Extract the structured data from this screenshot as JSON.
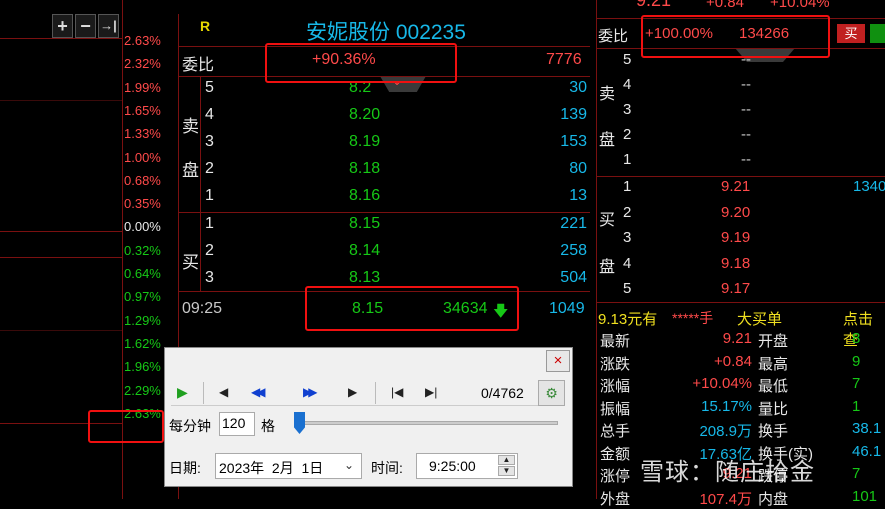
{
  "toolbar": {
    "add_label": "+",
    "minus_label": "−",
    "end_label": "→|"
  },
  "left_pcts": [
    "2.63%",
    "2.32%",
    "1.99%",
    "1.65%",
    "1.33%",
    "1.00%",
    "0.68%",
    "0.35%",
    "0.00%",
    "0.32%",
    "0.64%",
    "0.97%",
    "1.29%",
    "1.62%",
    "1.96%",
    "2.29%",
    "2.63%"
  ],
  "stock": {
    "marker": "R",
    "title": "安妮股份 002235"
  },
  "weibi": {
    "label": "委比",
    "value": "+90.36%",
    "diff": "7776"
  },
  "sell_label_1": "卖",
  "sell_label_2": "盘",
  "buy_label": "买",
  "sell_rows": [
    {
      "level": "5",
      "price": "8.2",
      "vol": "30"
    },
    {
      "level": "4",
      "price": "8.20",
      "vol": "139"
    },
    {
      "level": "3",
      "price": "8.19",
      "vol": "153"
    },
    {
      "level": "2",
      "price": "8.18",
      "vol": "80"
    },
    {
      "level": "1",
      "price": "8.16",
      "vol": "13"
    }
  ],
  "buy_rows": [
    {
      "level": "1",
      "price": "8.15",
      "vol": "221"
    },
    {
      "level": "2",
      "price": "8.14",
      "vol": "258"
    },
    {
      "level": "3",
      "price": "8.13",
      "vol": "504"
    }
  ],
  "trade": {
    "time": "09:25",
    "price": "8.15",
    "volume": "34634",
    "count": "1049"
  },
  "right": {
    "top_price": "9.21",
    "top_change": "+0.84",
    "top_pct": "+10.04%",
    "weibi_label": "委比",
    "weibi_value": "+100.00%",
    "weibi_diff": "134266",
    "buy_btn": "买",
    "sell_label_1": "卖",
    "sell_label_2": "盘",
    "buy_label_1": "买",
    "buy_label_2": "盘",
    "sell_levels": [
      {
        "level": "5",
        "val": "--"
      },
      {
        "level": "4",
        "val": "--"
      },
      {
        "level": "3",
        "val": "--"
      },
      {
        "level": "2",
        "val": "--"
      },
      {
        "level": "1",
        "val": "--"
      }
    ],
    "buy_levels": [
      {
        "level": "1",
        "val": "9.21",
        "vol": "1340"
      },
      {
        "level": "2",
        "val": "9.20",
        "vol": ""
      },
      {
        "level": "3",
        "val": "9.19",
        "vol": ""
      },
      {
        "level": "4",
        "val": "9.18",
        "vol": ""
      },
      {
        "level": "5",
        "val": "9.17",
        "vol": ""
      }
    ],
    "bigorder": {
      "amount": "9.13元有",
      "stars": "*****手",
      "label": "大买单",
      "link": "点击查"
    },
    "stats": [
      {
        "l": "最新",
        "v": "9.21",
        "l2": "开盘",
        "v2": "8"
      },
      {
        "l": "涨跌",
        "v": "+0.84",
        "l2": "最高",
        "v2": "9"
      },
      {
        "l": "涨幅",
        "v": "+10.04%",
        "l2": "最低",
        "v2": "7"
      },
      {
        "l": "振幅",
        "v": "15.17%",
        "l2": "量比",
        "v2": "1"
      },
      {
        "l": "总手",
        "v": "208.9万",
        "l2": "换手",
        "v2": "38.1"
      },
      {
        "l": "金额",
        "v": "17.63亿",
        "l2": "换手(实)",
        "v2": "46.1"
      },
      {
        "l": "涨停",
        "v": "9.21",
        "l2": "跌停",
        "v2": "7"
      },
      {
        "l": "外盘",
        "v": "107.4万",
        "l2": "内盘",
        "v2": "101"
      }
    ]
  },
  "dialog": {
    "close": "×",
    "counter": "0/4762",
    "speed_label": "每分钟",
    "speed_value": "120",
    "speed_unit": "格",
    "date_label": "日期:",
    "date_value": "2023年  2月  1日",
    "time_label": "时间:",
    "time_value": "9:25:00"
  },
  "watermark": "雪球：随庄拾金"
}
